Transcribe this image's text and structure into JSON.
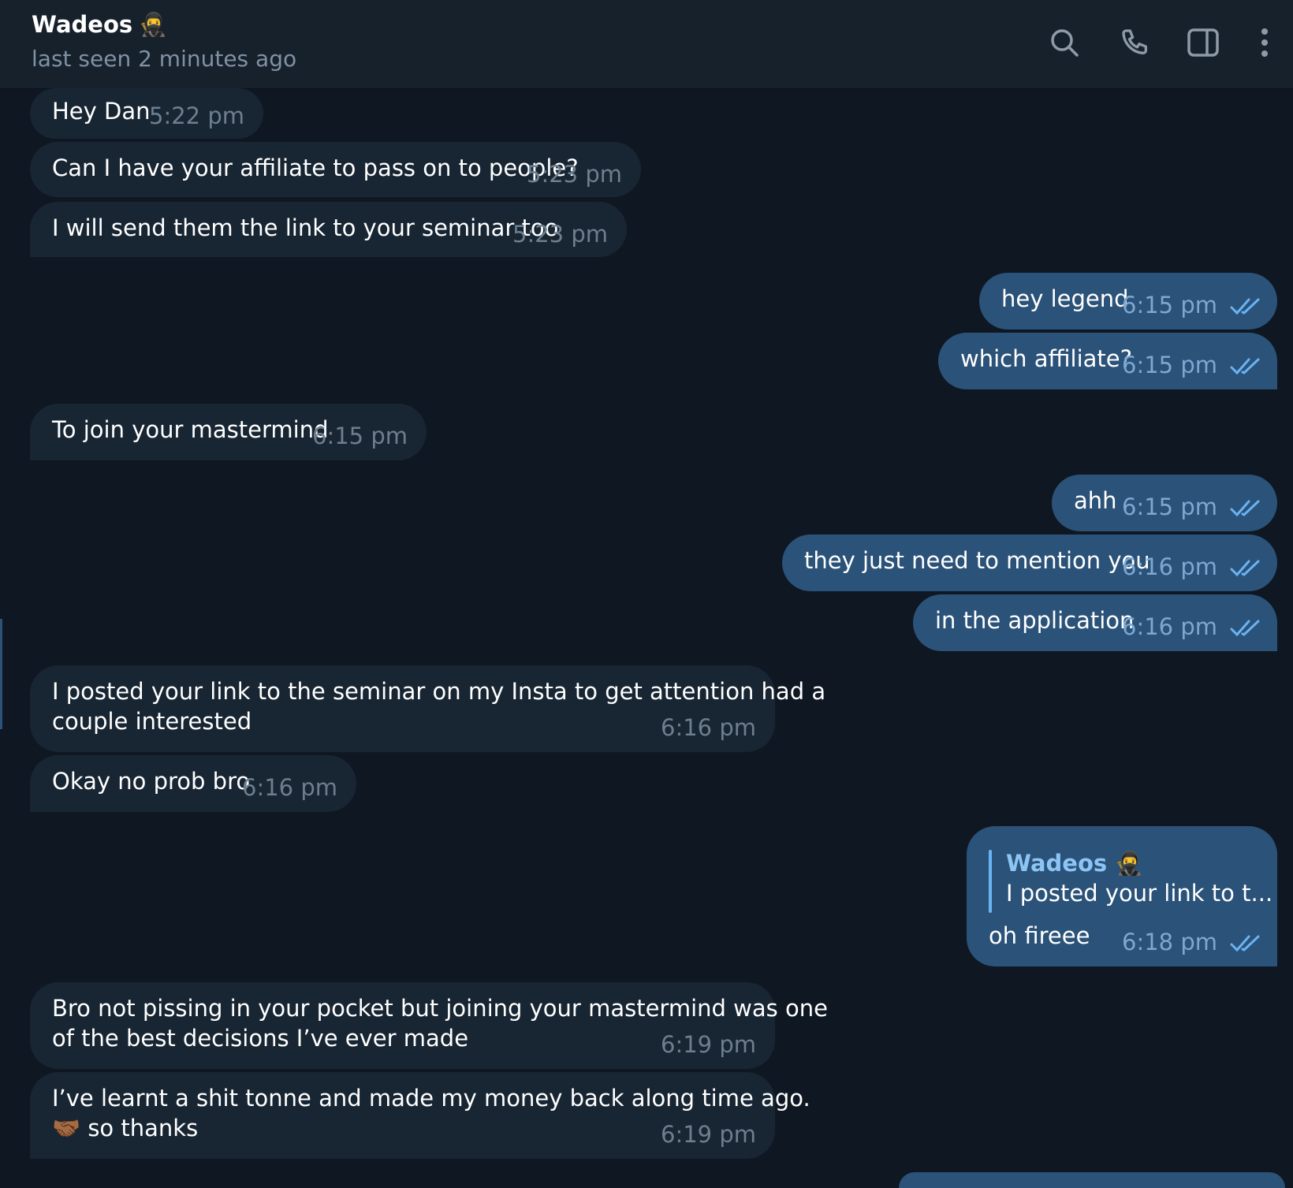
{
  "header": {
    "contact_name": "Wadeos",
    "contact_emoji": "🥷",
    "status": "last seen 2 minutes ago",
    "icons": [
      "search-icon",
      "phone-icon",
      "sidebar-toggle-icon",
      "more-options-icon"
    ]
  },
  "colors": {
    "background": "#0f1722",
    "header": "#17212b",
    "incoming_bubble": "#182533",
    "outgoing_bubble": "#2b5278",
    "read_ticks": "#6ab3f3",
    "accent": "#8cc5f5"
  },
  "messages": [
    {
      "dir": "in",
      "text": "Hey Dan",
      "time": "5:22 pm"
    },
    {
      "dir": "in",
      "text": "Can I have your affiliate to pass on to people?",
      "time": "5:23 pm"
    },
    {
      "dir": "in",
      "text": "I will send them the link to your seminar too",
      "time": "5:23 pm"
    },
    {
      "dir": "out",
      "text": "hey legend",
      "time": "6:15 pm",
      "status": "read"
    },
    {
      "dir": "out",
      "text": "which affiliate?",
      "time": "6:15 pm",
      "status": "read"
    },
    {
      "dir": "in",
      "text": "To join your mastermind",
      "time": "6:15 pm"
    },
    {
      "dir": "out",
      "text": "ahh",
      "time": "6:15 pm",
      "status": "read"
    },
    {
      "dir": "out",
      "text": "they just need to mention you",
      "time": "6:16 pm",
      "status": "read"
    },
    {
      "dir": "out",
      "text": "in the application",
      "time": "6:16 pm",
      "status": "read"
    },
    {
      "dir": "in",
      "lines": [
        "I posted your link to the seminar on my Insta to get attention had a",
        "couple interested"
      ],
      "time": "6:16 pm"
    },
    {
      "dir": "in",
      "text": "Okay no prob bro",
      "time": "6:16 pm"
    },
    {
      "dir": "out",
      "reply_to": {
        "name": "Wadeos",
        "emoji": "🥷",
        "text": "I posted your link to t..."
      },
      "text": "oh fireee",
      "time": "6:18 pm",
      "status": "read"
    },
    {
      "dir": "in",
      "lines": [
        "Bro not pissing in your pocket but joining your mastermind was one",
        "of the best decisions I’ve ever made"
      ],
      "time": "6:19 pm"
    },
    {
      "dir": "in",
      "lines": [
        "I’ve learnt a shit tonne and made my money back along time ago.",
        "🤝🏾 so thanks"
      ],
      "time": "6:19 pm"
    }
  ]
}
